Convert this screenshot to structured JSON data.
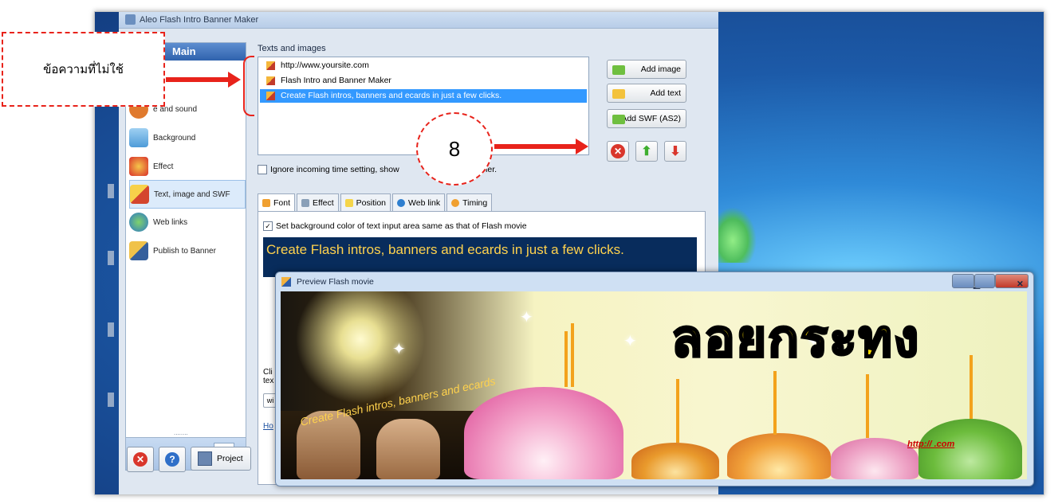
{
  "app": {
    "title": "Aleo Flash Intro Banner Maker"
  },
  "sidebar": {
    "header": "Main",
    "items": [
      {
        "label": "",
        "icon": "text-icon"
      },
      {
        "label": "e and sound",
        "icon": "music-icon"
      },
      {
        "label": "Background",
        "icon": "background-icon"
      },
      {
        "label": "Effect",
        "icon": "effect-icon"
      },
      {
        "label": "Text, image and SWF",
        "icon": "pen-icon"
      },
      {
        "label": "Web links",
        "icon": "globe-icon"
      },
      {
        "label": "Publish to Banner",
        "icon": "publish-icon"
      }
    ],
    "grip": "........"
  },
  "bottom_bar": {
    "project_label": "Project"
  },
  "texts_panel": {
    "label": "Texts and images",
    "items": [
      "http://www.yoursite.com",
      "Flash Intro and Banner Maker",
      "Create Flash intros, banners and ecards in just a few clicks."
    ],
    "selected_index": 2,
    "add_image": "Add image",
    "add_text": "Add text",
    "add_swf": "Add SWF (AS2)",
    "ignore_time_label_a": "Ignore incoming time setting, show",
    "ignore_time_label_b": "r another.",
    "ignore_time_checked": false
  },
  "tabs": [
    {
      "label": "Font",
      "color": "#f0a030"
    },
    {
      "label": "Effect",
      "color": "#8aa0b8"
    },
    {
      "label": "Position",
      "color": "#f5d54a"
    },
    {
      "label": "Web link",
      "color": "#2f7fcf"
    },
    {
      "label": "Timing",
      "color": "#f0a030"
    }
  ],
  "font_tab": {
    "bg_same_label": "Set background color of text input area same as that of Flash movie",
    "bg_same_checked": true,
    "text_value": "Create Flash intros, banners and ecards in just a few clicks.",
    "clipped_lines": [
      "Cli",
      "tex",
      "wi",
      "Ho"
    ]
  },
  "preview": {
    "title": "Preview Flash movie",
    "banner_title": "ลอยกระทง",
    "scroll_text": "Create Flash intros, banners and ecards",
    "url_text": "http://                 .com"
  },
  "annotations": {
    "callout_text": "ข้อความที่ไม่ใช้",
    "step_number": "8",
    "accent": "#e8231b"
  }
}
